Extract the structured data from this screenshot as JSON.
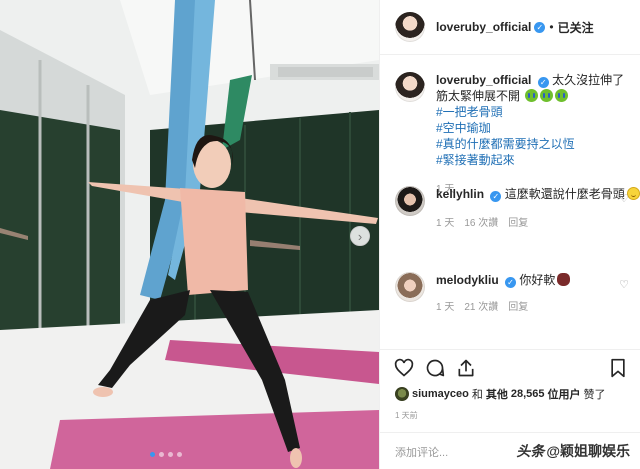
{
  "post": {
    "author": "loveruby_official",
    "follow_status": "已关注",
    "separator": "•",
    "caption_lines": [
      "太久沒拉伸了",
      "筋太緊伸展不開"
    ],
    "hashtags": [
      "#一把老骨頭",
      "#空中瑜珈",
      "#真的什麼都需要持之以恆",
      "#緊接著動起來"
    ],
    "caption_time": "1 天"
  },
  "comments": [
    {
      "user": "kellyhlin",
      "text": "這麼軟還說什麼老骨頭",
      "time": "1 天",
      "likes": "16 次讚",
      "reply": "回复"
    },
    {
      "user": "melodykliu",
      "text": "你好軟",
      "time": "1 天",
      "likes": "21 次讚",
      "reply": "回复"
    }
  ],
  "likes": {
    "user": "siumayceo",
    "and": "和",
    "others_label": "其他",
    "count": "28,565",
    "unit": "位用户",
    "suffix": "赞了"
  },
  "timestamp": "1 天前",
  "add_comment_placeholder": "添加评论...",
  "watermark": {
    "prefix": "头条",
    "handle": "@颖姐聊娱乐"
  },
  "icons": {
    "verified": "verified-badge-icon",
    "heart": "heart-icon",
    "comment": "comment-icon",
    "share": "share-icon",
    "save": "bookmark-icon",
    "next": "chevron-right-icon"
  },
  "colors": {
    "accent": "#3897f0",
    "hashtag": "#1f6fb5",
    "muted": "#999999"
  }
}
